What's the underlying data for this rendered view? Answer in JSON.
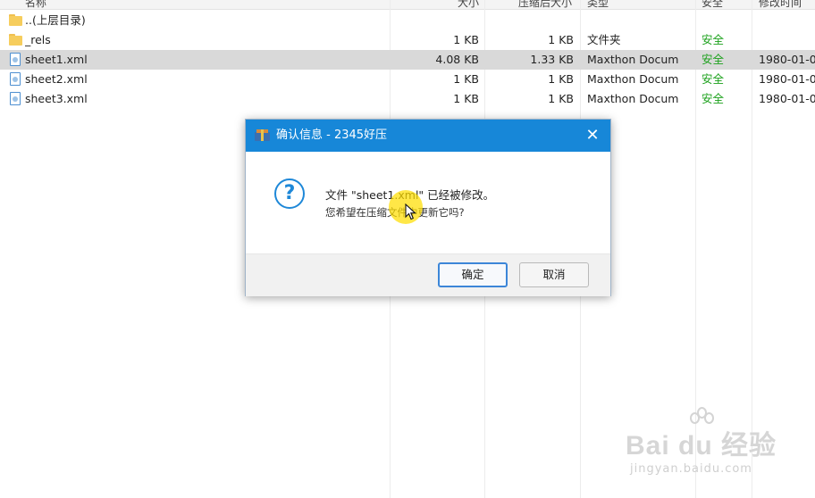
{
  "columns": {
    "name": "名称",
    "size": "大小",
    "compressed": "压缩后大小",
    "type": "类型",
    "security": "安全",
    "modified": "修改时间"
  },
  "files": [
    {
      "name": "..(上层目录)",
      "icon": "folder-icon",
      "size": "",
      "compressed": "",
      "type": "",
      "security": "",
      "modified": "",
      "selected": false
    },
    {
      "name": "_rels",
      "icon": "folder-icon",
      "size": "1 KB",
      "compressed": "1 KB",
      "type": "文件夹",
      "security": "安全",
      "modified": "",
      "selected": false
    },
    {
      "name": "sheet1.xml",
      "icon": "xml-file-icon",
      "size": "4.08 KB",
      "compressed": "1.33 KB",
      "type": "Maxthon Docum",
      "security": "安全",
      "modified": "1980-01-0",
      "selected": true
    },
    {
      "name": "sheet2.xml",
      "icon": "xml-file-icon",
      "size": "1 KB",
      "compressed": "1 KB",
      "type": "Maxthon Docum",
      "security": "安全",
      "modified": "1980-01-0",
      "selected": false
    },
    {
      "name": "sheet3.xml",
      "icon": "xml-file-icon",
      "size": "1 KB",
      "compressed": "1 KB",
      "type": "Maxthon Docum",
      "security": "安全",
      "modified": "1980-01-0",
      "selected": false
    }
  ],
  "dialog": {
    "title": "确认信息 - 2345好压",
    "message_line1": "文件 \"sheet1.xml\" 已经被修改。",
    "message_line2": "您希望在压缩文件中更新它吗?",
    "ok_label": "确定",
    "cancel_label": "取消",
    "close_glyph": "✕",
    "question_glyph": "?"
  },
  "watermark": {
    "main": "Bai du 经验",
    "sub": "jingyan.baidu.com"
  },
  "colors": {
    "title_bar": "#1787d8",
    "safe_text": "#1aa01a",
    "selected_row": "#d9d9d9",
    "accent": "#1e88d8"
  }
}
